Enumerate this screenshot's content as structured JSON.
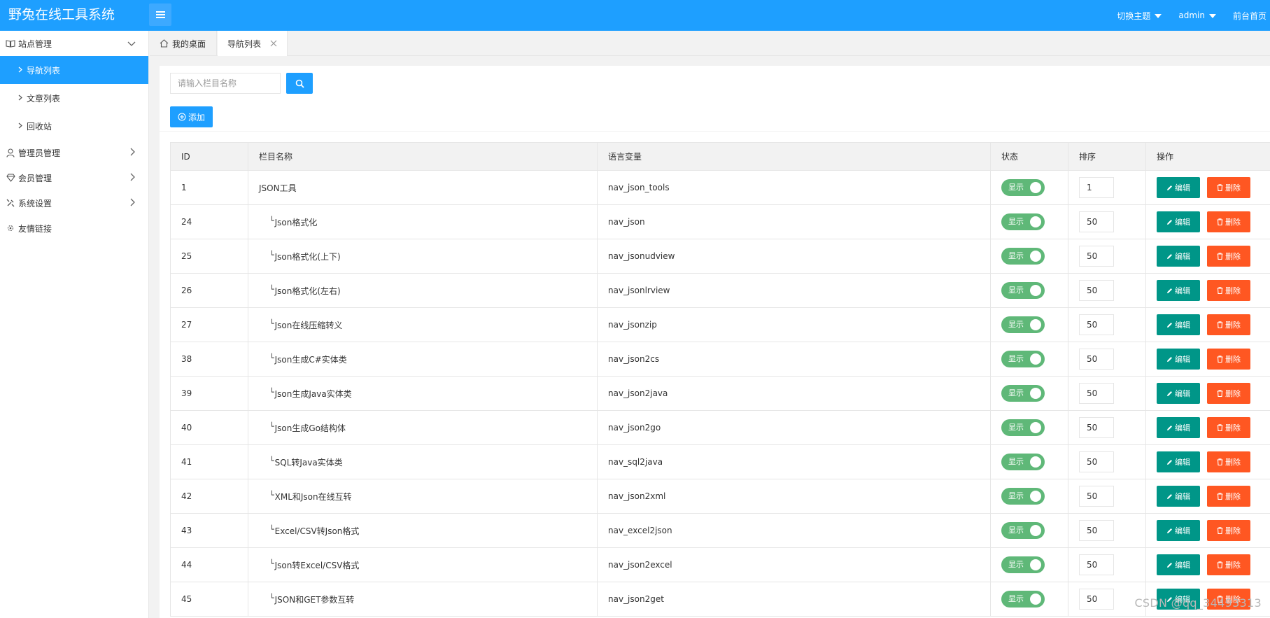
{
  "header": {
    "logo": "野兔在线工具系统",
    "theme_label": "切换主题",
    "user_label": "admin",
    "home_label": "前台首页"
  },
  "sidebar": {
    "groups": [
      {
        "label": "站点管理",
        "icon": "book-icon"
      },
      {
        "label": "管理员管理",
        "icon": "user-icon"
      },
      {
        "label": "会员管理",
        "icon": "diamond-icon"
      },
      {
        "label": "系统设置",
        "icon": "wrench-icon"
      },
      {
        "label": "友情链接",
        "icon": "link-icon"
      }
    ],
    "subitems": [
      {
        "label": "导航列表",
        "active": true
      },
      {
        "label": "文章列表"
      },
      {
        "label": "回收站"
      }
    ]
  },
  "tabs": [
    {
      "label": "我的桌面",
      "icon": "home-icon"
    },
    {
      "label": "导航列表",
      "closable": true
    }
  ],
  "toolbar": {
    "search_placeholder": "请输入栏目名称",
    "add_label": "添加"
  },
  "table": {
    "columns": [
      "ID",
      "栏目名称",
      "语言变量",
      "状态",
      "排序",
      "操作"
    ],
    "child_prefix": "└",
    "status_label": "显示",
    "edit_label": "编辑",
    "delete_label": "删除",
    "rows": [
      {
        "id": "1",
        "name": "JSON工具",
        "var": "nav_json_tools",
        "sort": "1",
        "child": false
      },
      {
        "id": "24",
        "name": "Json格式化",
        "var": "nav_json",
        "sort": "50",
        "child": true
      },
      {
        "id": "25",
        "name": "Json格式化(上下)",
        "var": "nav_jsonudview",
        "sort": "50",
        "child": true
      },
      {
        "id": "26",
        "name": "Json格式化(左右)",
        "var": "nav_jsonlrview",
        "sort": "50",
        "child": true
      },
      {
        "id": "27",
        "name": "Json在线压缩转义",
        "var": "nav_jsonzip",
        "sort": "50",
        "child": true
      },
      {
        "id": "38",
        "name": "Json生成C#实体类",
        "var": "nav_json2cs",
        "sort": "50",
        "child": true
      },
      {
        "id": "39",
        "name": "Json生成Java实体类",
        "var": "nav_json2java",
        "sort": "50",
        "child": true
      },
      {
        "id": "40",
        "name": "Json生成Go结构体",
        "var": "nav_json2go",
        "sort": "50",
        "child": true
      },
      {
        "id": "41",
        "name": "SQL转Java实体类",
        "var": "nav_sql2java",
        "sort": "50",
        "child": true
      },
      {
        "id": "42",
        "name": "XML和Json在线互转",
        "var": "nav_json2xml",
        "sort": "50",
        "child": true
      },
      {
        "id": "43",
        "name": "Excel/CSV转Json格式",
        "var": "nav_excel2json",
        "sort": "50",
        "child": true
      },
      {
        "id": "44",
        "name": "Json转Excel/CSV格式",
        "var": "nav_json2excel",
        "sort": "50",
        "child": true
      },
      {
        "id": "45",
        "name": "JSON和GET参数互转",
        "var": "nav_json2get",
        "sort": "50",
        "child": true
      }
    ]
  },
  "watermark": "CSDN @qq_34493313",
  "colors": {
    "primary": "#1e9fff",
    "switch_on": "#5fb878",
    "edit": "#009688",
    "delete": "#ff5722"
  }
}
